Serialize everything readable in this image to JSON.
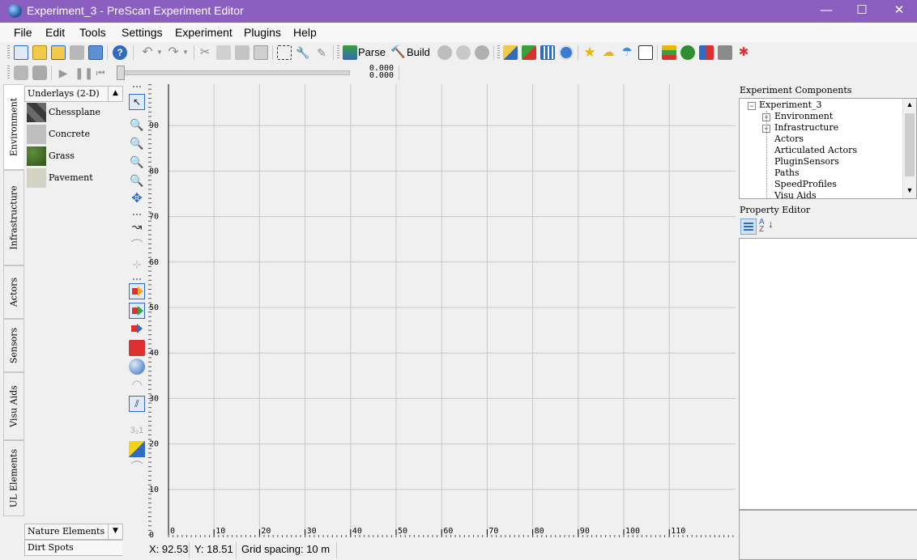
{
  "window": {
    "title": "Experiment_3 - PreScan Experiment Editor",
    "icon": "globe-app-icon",
    "controls": {
      "minimize": "—",
      "maximize": "☐",
      "close": "✕"
    }
  },
  "menu": {
    "items": [
      "File",
      "Edit",
      "Tools",
      "Settings",
      "Experiment",
      "Plugins",
      "Help"
    ]
  },
  "toolbar": {
    "parse_label": "Parse",
    "build_label": "Build",
    "scene_start_value": "0.000",
    "scene_end_value": "0.000"
  },
  "side_tabs": [
    "Environment",
    "Infrastructure",
    "Actors",
    "Sensors",
    "Visu Aids",
    "UL Elements"
  ],
  "left_panel": {
    "section_title": "Underlays (2-D)",
    "underlays": [
      {
        "label": "Chessplane",
        "swatch": "#505050"
      },
      {
        "label": "Concrete",
        "swatch": "#bfbfbf"
      },
      {
        "label": "Grass",
        "swatch": "#3e6b2a"
      },
      {
        "label": "Pavement",
        "swatch": "#d3d3c4"
      }
    ],
    "bottom_sections": [
      "Nature Elements",
      "Dirt Spots"
    ]
  },
  "canvas": {
    "y_ticks": [
      "90",
      "80",
      "70",
      "60",
      "50",
      "40",
      "30",
      "20",
      "10",
      "0"
    ],
    "x_ticks": [
      "0",
      "10",
      "20",
      "30",
      "40",
      "50",
      "60",
      "70",
      "80",
      "90",
      "100",
      "110"
    ]
  },
  "status": {
    "x_readout": "X: 92.53",
    "y_readout": "Y: 18.51",
    "grid_spacing": "Grid spacing: 10 m"
  },
  "right_panel": {
    "components_title": "Experiment Components",
    "tree_root": "Experiment_3",
    "tree_children": [
      {
        "label": "Environment",
        "expandable": true
      },
      {
        "label": "Infrastructure",
        "expandable": true
      },
      {
        "label": "Actors",
        "expandable": false
      },
      {
        "label": "Articulated Actors",
        "expandable": false
      },
      {
        "label": "PluginSensors",
        "expandable": false
      },
      {
        "label": "Paths",
        "expandable": false
      },
      {
        "label": "SpeedProfiles",
        "expandable": false
      },
      {
        "label": "Visu Aids",
        "expandable": false
      }
    ],
    "property_title": "Property Editor",
    "sort_buttons": [
      "categorized-sort-icon",
      "alphabetical-sort-icon"
    ]
  },
  "colors": {
    "titlebar": "#8b5fbf",
    "grid_line": "#c8c8c8",
    "canvas_bg": "#f0f0f0"
  }
}
